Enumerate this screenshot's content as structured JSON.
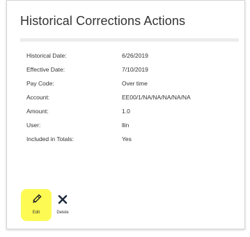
{
  "panel": {
    "title": "Historical Corrections Actions"
  },
  "details": [
    {
      "label": "Historical Date:",
      "value": "6/26/2019"
    },
    {
      "label": "Effective Date:",
      "value": "7/10/2019"
    },
    {
      "label": "Pay Code:",
      "value": "Over time"
    },
    {
      "label": "Account:",
      "value": "EE00/1/NA/NA/NA/NA/NA"
    },
    {
      "label": "Amount:",
      "value": "1.0"
    },
    {
      "label": "User:",
      "value": "llin"
    },
    {
      "label": "Included in Totals:",
      "value": "Yes"
    }
  ],
  "actions": {
    "edit_label": "Edit",
    "edit_icon": "pencil-icon",
    "delete_label": "Delete",
    "delete_icon": "close-icon",
    "highlight_color": "#fdfa54"
  }
}
